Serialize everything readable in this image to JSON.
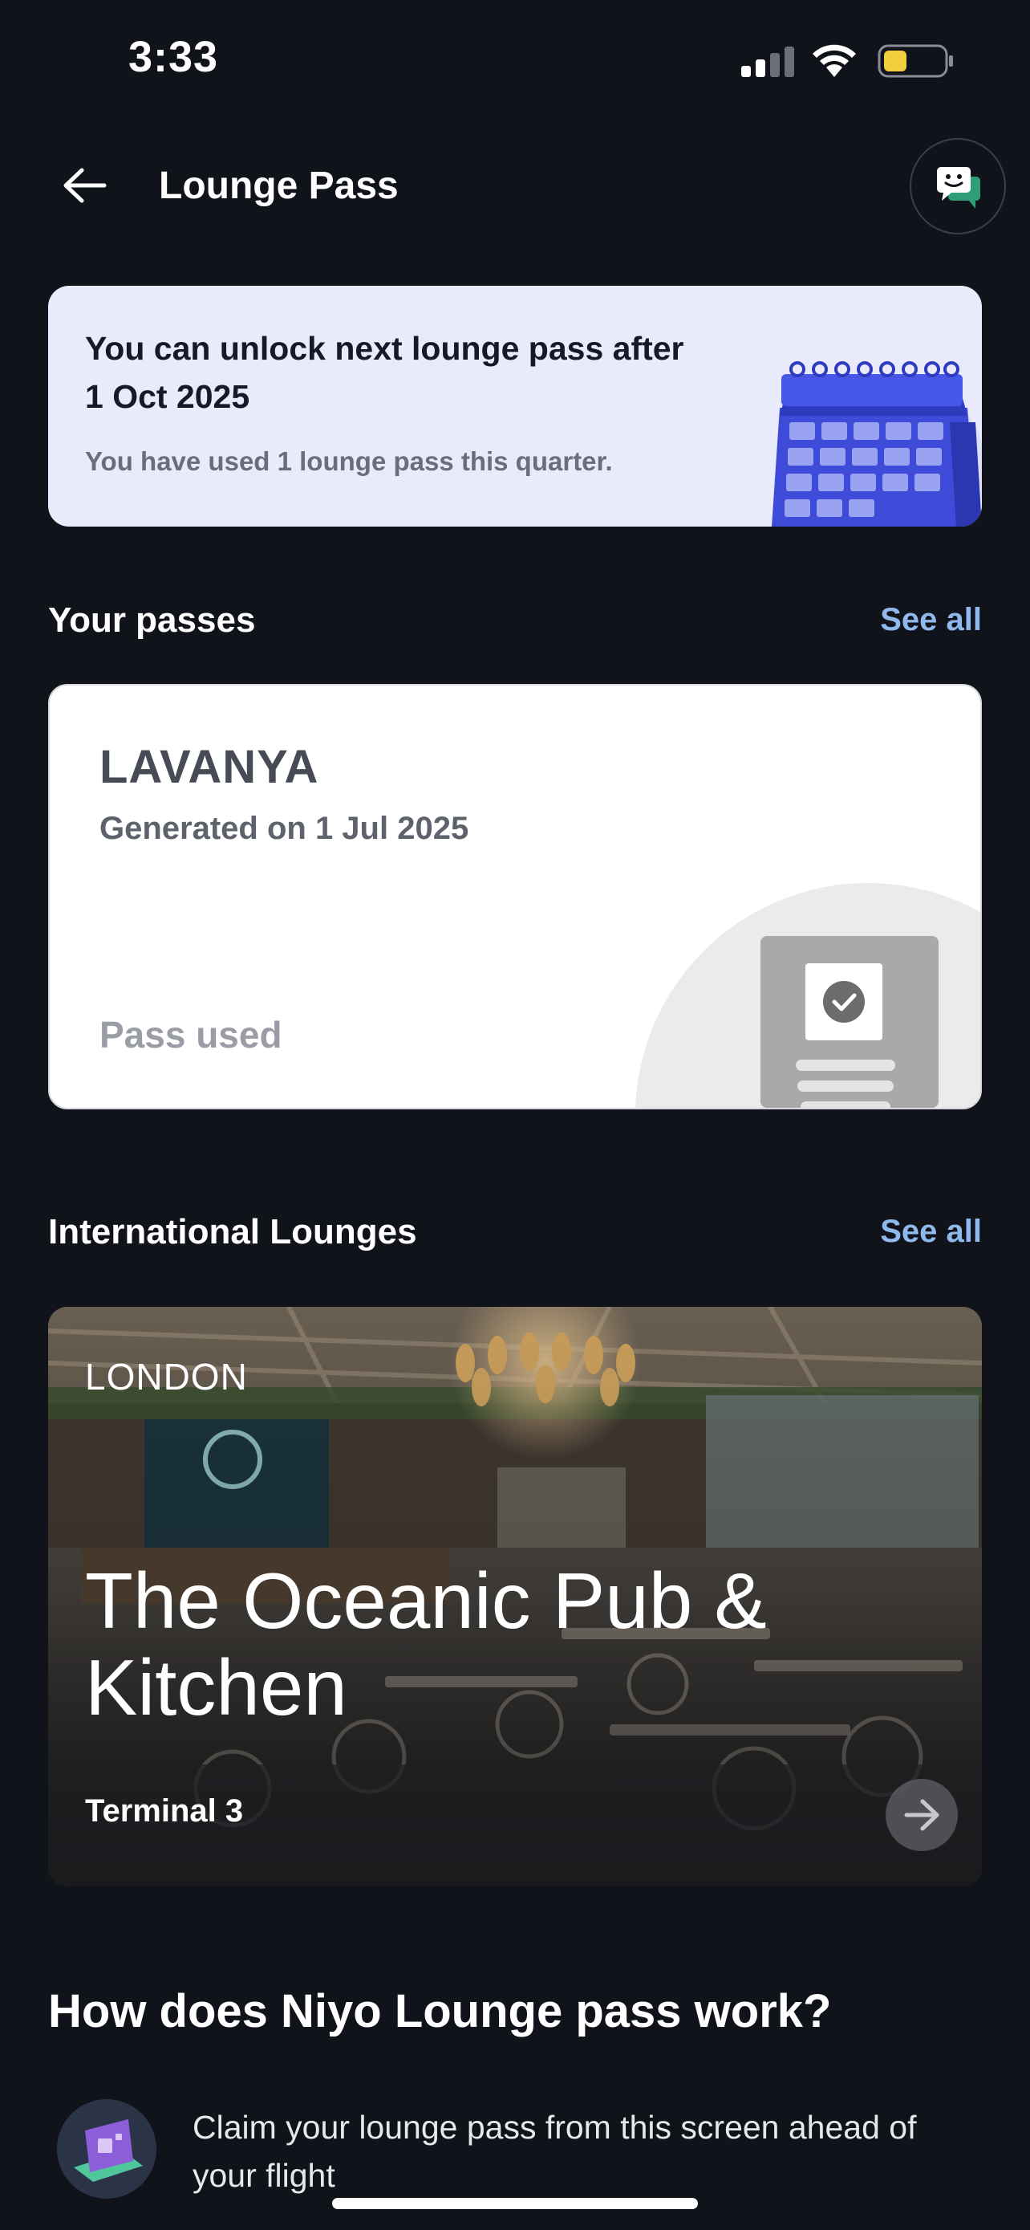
{
  "status_bar": {
    "time": "3:33"
  },
  "header": {
    "title": "Lounge Pass"
  },
  "unlock_banner": {
    "title": "You can unlock next lounge pass after 1 Oct 2025",
    "subtitle": "You have used 1 lounge pass this quarter."
  },
  "passes_section": {
    "title": "Your passes",
    "see_all": "See all"
  },
  "pass_card": {
    "name": "LAVANYA",
    "generated": "Generated on 1 Jul 2025",
    "status": "Pass used"
  },
  "lounges_section": {
    "title": "International Lounges",
    "see_all": "See all"
  },
  "lounge_card": {
    "city": "LONDON",
    "name": "The Oceanic Pub & Kitchen",
    "terminal": "Terminal 3"
  },
  "how_it_works": {
    "title": "How does Niyo Lounge pass work?",
    "steps": [
      {
        "text": "Claim your lounge pass from this screen ahead of your flight",
        "icon": "ticket-icon"
      }
    ]
  },
  "colors": {
    "background": "#11131b",
    "banner": "#e9ebfd",
    "accent_link": "#8fb9ec",
    "calendar_blue": "#3d4bd8"
  }
}
